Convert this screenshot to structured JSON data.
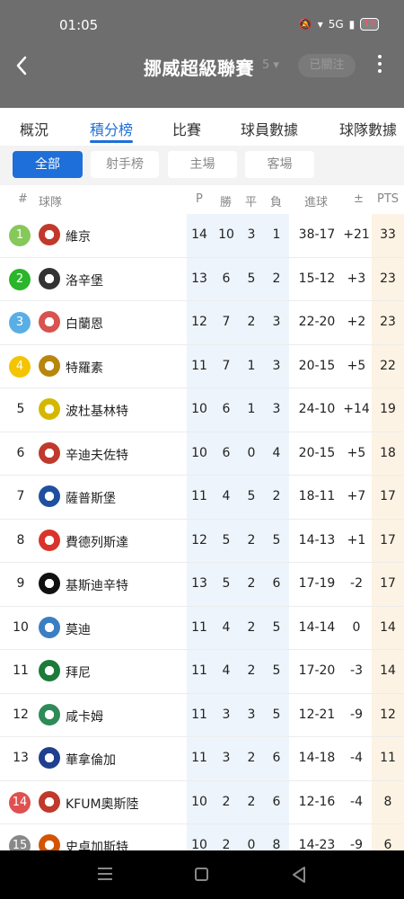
{
  "status": {
    "time": "01:05",
    "battery": "19",
    "net_label": "5G"
  },
  "header": {
    "title": "挪威超級聯賽",
    "season": "5 ▾",
    "follow_label": "已關注"
  },
  "tabs": [
    {
      "label": "概況"
    },
    {
      "label": "積分榜",
      "active": true
    },
    {
      "label": "比賽"
    },
    {
      "label": "球員數據"
    },
    {
      "label": "球隊數據"
    }
  ],
  "subtabs": [
    {
      "label": "全部",
      "active": true
    },
    {
      "label": "射手榜"
    },
    {
      "label": "主場"
    },
    {
      "label": "客場"
    }
  ],
  "table_header": {
    "rank": "#",
    "team": "球隊",
    "p": "P",
    "w": "勝",
    "d": "平",
    "l": "負",
    "goals": "進球",
    "gd": "±",
    "pts": "PTS"
  },
  "colors": {
    "accent": "#1e6fd9",
    "zone_green_light": "#86c85a",
    "zone_green": "#2ab52a",
    "zone_blue": "#5aaee6",
    "zone_yellow": "#f4c400",
    "zone_red": "#e05050",
    "zone_grey": "#888888"
  },
  "standings": [
    {
      "rank": "1",
      "zone": "#86c85a",
      "logo_color": "#c0392b",
      "team": "維京",
      "p": "14",
      "w": "10",
      "d": "3",
      "l": "1",
      "goals": "38-17",
      "gd": "+21",
      "pts": "33"
    },
    {
      "rank": "2",
      "zone": "#2ab52a",
      "logo_color": "#333333",
      "team": "洛辛堡",
      "p": "13",
      "w": "6",
      "d": "5",
      "l": "2",
      "goals": "15-12",
      "gd": "+3",
      "pts": "23"
    },
    {
      "rank": "3",
      "zone": "#5aaee6",
      "logo_color": "#d9534f",
      "team": "白蘭恩",
      "p": "12",
      "w": "7",
      "d": "2",
      "l": "3",
      "goals": "22-20",
      "gd": "+2",
      "pts": "23"
    },
    {
      "rank": "4",
      "zone": "#f4c400",
      "logo_color": "#b8860b",
      "team": "特羅素",
      "p": "11",
      "w": "7",
      "d": "1",
      "l": "3",
      "goals": "20-15",
      "gd": "+5",
      "pts": "22"
    },
    {
      "rank": "5",
      "zone": "",
      "logo_color": "#d4b800",
      "team": "波杜基林特",
      "p": "10",
      "w": "6",
      "d": "1",
      "l": "3",
      "goals": "24-10",
      "gd": "+14",
      "pts": "19"
    },
    {
      "rank": "6",
      "zone": "",
      "logo_color": "#c0392b",
      "team": "辛迪夫佐特",
      "p": "10",
      "w": "6",
      "d": "0",
      "l": "4",
      "goals": "20-15",
      "gd": "+5",
      "pts": "18"
    },
    {
      "rank": "7",
      "zone": "",
      "logo_color": "#1f4fa0",
      "team": "薩普斯堡",
      "p": "11",
      "w": "4",
      "d": "5",
      "l": "2",
      "goals": "18-11",
      "gd": "+7",
      "pts": "17"
    },
    {
      "rank": "8",
      "zone": "",
      "logo_color": "#d9342b",
      "team": "費德列斯達",
      "p": "12",
      "w": "5",
      "d": "2",
      "l": "5",
      "goals": "14-13",
      "gd": "+1",
      "pts": "17"
    },
    {
      "rank": "9",
      "zone": "",
      "logo_color": "#111111",
      "team": "基斯迪辛特",
      "p": "13",
      "w": "5",
      "d": "2",
      "l": "6",
      "goals": "17-19",
      "gd": "-2",
      "pts": "17"
    },
    {
      "rank": "10",
      "zone": "",
      "logo_color": "#3a7fc4",
      "team": "莫迪",
      "p": "11",
      "w": "4",
      "d": "2",
      "l": "5",
      "goals": "14-14",
      "gd": "0",
      "pts": "14"
    },
    {
      "rank": "11",
      "zone": "",
      "logo_color": "#1d7a3a",
      "team": "拜尼",
      "p": "11",
      "w": "4",
      "d": "2",
      "l": "5",
      "goals": "17-20",
      "gd": "-3",
      "pts": "14"
    },
    {
      "rank": "12",
      "zone": "",
      "logo_color": "#2e8b57",
      "team": "咸卡姆",
      "p": "11",
      "w": "3",
      "d": "3",
      "l": "5",
      "goals": "12-21",
      "gd": "-9",
      "pts": "12"
    },
    {
      "rank": "13",
      "zone": "",
      "logo_color": "#1f3f8f",
      "team": "華拿倫加",
      "p": "11",
      "w": "3",
      "d": "2",
      "l": "6",
      "goals": "14-18",
      "gd": "-4",
      "pts": "11"
    },
    {
      "rank": "14",
      "zone": "#e05050",
      "logo_color": "#c0392b",
      "team": "KFUM奧斯陸",
      "p": "10",
      "w": "2",
      "d": "2",
      "l": "6",
      "goals": "12-16",
      "gd": "-4",
      "pts": "8"
    },
    {
      "rank": "15",
      "zone": "#888888",
      "logo_color": "#d35400",
      "team": "史卓加斯特",
      "p": "10",
      "w": "2",
      "d": "0",
      "l": "8",
      "goals": "14-23",
      "gd": "-9",
      "pts": "6"
    }
  ]
}
